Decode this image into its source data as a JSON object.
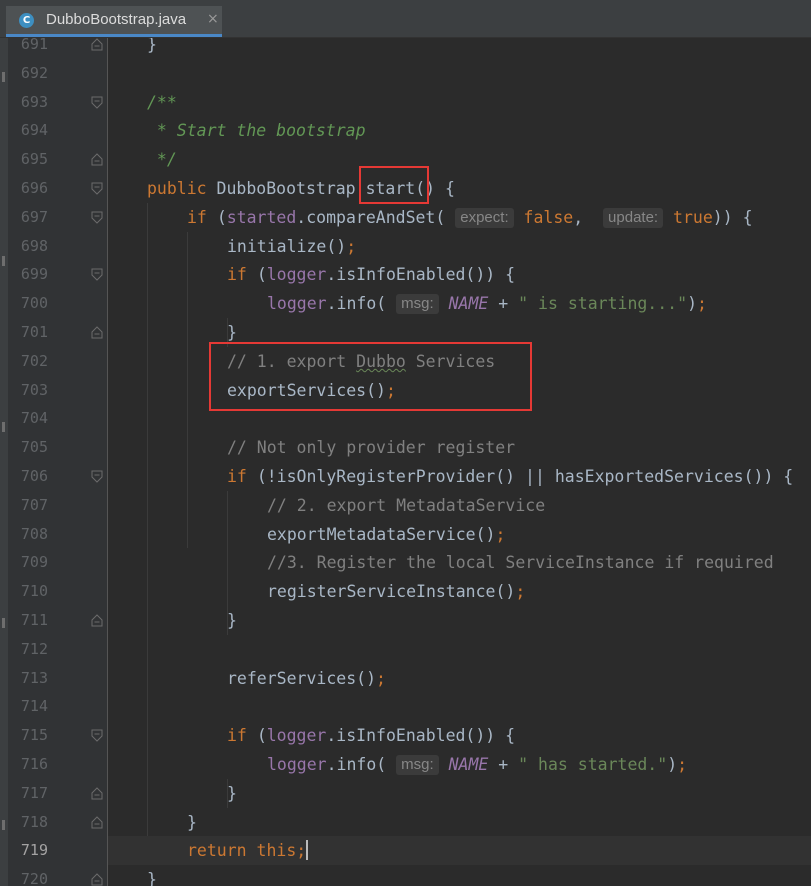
{
  "tab": {
    "icon_letter": "C",
    "label": "DubboBootstrap.java",
    "close": "×"
  },
  "rows": [
    {
      "ln": "691",
      "fold": "end",
      "indent": 1,
      "segs": [
        [
          "p",
          "}"
        ]
      ]
    },
    {
      "ln": "692",
      "fold": "",
      "indent": 0,
      "segs": []
    },
    {
      "ln": "693",
      "fold": "start",
      "indent": 1,
      "segs": [
        [
          "doc",
          "/**"
        ]
      ]
    },
    {
      "ln": "694",
      "fold": "",
      "indent": 1,
      "segs": [
        [
          "doc",
          " * Start the bootstrap"
        ]
      ]
    },
    {
      "ln": "695",
      "fold": "end",
      "indent": 1,
      "segs": [
        [
          "doc",
          " */"
        ]
      ]
    },
    {
      "ln": "696",
      "fold": "start",
      "indent": 1,
      "segs": [
        [
          "kw",
          "public "
        ],
        [
          "p",
          "DubboBootstrap "
        ],
        [
          "p",
          "start"
        ],
        [
          "p",
          "() {"
        ]
      ]
    },
    {
      "ln": "697",
      "fold": "start",
      "indent": 2,
      "segs": [
        [
          "kw",
          "if "
        ],
        [
          "p",
          "("
        ],
        [
          "field",
          "started"
        ],
        [
          "p",
          ".compareAndSet( "
        ],
        [
          "hint",
          "expect:"
        ],
        [
          "kw",
          " false"
        ],
        [
          "p",
          ",  "
        ],
        [
          "hint",
          "update:"
        ],
        [
          "kw",
          " true"
        ],
        [
          "p",
          ")) {"
        ]
      ]
    },
    {
      "ln": "698",
      "fold": "",
      "indent": 3,
      "segs": [
        [
          "p",
          "initialize()"
        ],
        [
          "kw",
          ";"
        ]
      ]
    },
    {
      "ln": "699",
      "fold": "start",
      "indent": 3,
      "segs": [
        [
          "kw",
          "if "
        ],
        [
          "p",
          "("
        ],
        [
          "field",
          "logger"
        ],
        [
          "p",
          ".isInfoEnabled()) {"
        ]
      ]
    },
    {
      "ln": "700",
      "fold": "",
      "indent": 4,
      "segs": [
        [
          "field",
          "logger"
        ],
        [
          "p",
          ".info( "
        ],
        [
          "hint",
          "msg:"
        ],
        [
          "p",
          " "
        ],
        [
          "const",
          "NAME"
        ],
        [
          "p",
          " + "
        ],
        [
          "str",
          "\" is starting...\""
        ],
        [
          "p",
          ")"
        ],
        [
          "kw",
          ";"
        ]
      ]
    },
    {
      "ln": "701",
      "fold": "end",
      "indent": 3,
      "segs": [
        [
          "p",
          "}"
        ]
      ]
    },
    {
      "ln": "702",
      "fold": "",
      "indent": 3,
      "segs": [
        [
          "cmt",
          "// 1. export "
        ],
        [
          "cmtu",
          "Dubbo"
        ],
        [
          "cmt",
          " Services"
        ]
      ]
    },
    {
      "ln": "703",
      "fold": "",
      "indent": 3,
      "segs": [
        [
          "p",
          "exportServices()"
        ],
        [
          "kw",
          ";"
        ]
      ]
    },
    {
      "ln": "704",
      "fold": "",
      "indent": 0,
      "segs": []
    },
    {
      "ln": "705",
      "fold": "",
      "indent": 3,
      "segs": [
        [
          "cmt",
          "// Not only provider register"
        ]
      ]
    },
    {
      "ln": "706",
      "fold": "start",
      "indent": 3,
      "segs": [
        [
          "kw",
          "if "
        ],
        [
          "p",
          "(!isOnlyRegisterProvider() || hasExportedServices()) {"
        ]
      ]
    },
    {
      "ln": "707",
      "fold": "",
      "indent": 4,
      "segs": [
        [
          "cmt",
          "// 2. export MetadataService"
        ]
      ]
    },
    {
      "ln": "708",
      "fold": "",
      "indent": 4,
      "segs": [
        [
          "p",
          "exportMetadataService()"
        ],
        [
          "kw",
          ";"
        ]
      ]
    },
    {
      "ln": "709",
      "fold": "",
      "indent": 4,
      "segs": [
        [
          "cmt",
          "//3. Register the local ServiceInstance if required"
        ]
      ]
    },
    {
      "ln": "710",
      "fold": "",
      "indent": 4,
      "segs": [
        [
          "p",
          "registerServiceInstance()"
        ],
        [
          "kw",
          ";"
        ]
      ]
    },
    {
      "ln": "711",
      "fold": "end",
      "indent": 3,
      "segs": [
        [
          "p",
          "}"
        ]
      ]
    },
    {
      "ln": "712",
      "fold": "",
      "indent": 0,
      "segs": []
    },
    {
      "ln": "713",
      "fold": "",
      "indent": 3,
      "segs": [
        [
          "p",
          "referServices()"
        ],
        [
          "kw",
          ";"
        ]
      ]
    },
    {
      "ln": "714",
      "fold": "",
      "indent": 0,
      "segs": []
    },
    {
      "ln": "715",
      "fold": "start",
      "indent": 3,
      "segs": [
        [
          "kw",
          "if "
        ],
        [
          "p",
          "("
        ],
        [
          "field",
          "logger"
        ],
        [
          "p",
          ".isInfoEnabled()) {"
        ]
      ]
    },
    {
      "ln": "716",
      "fold": "",
      "indent": 4,
      "segs": [
        [
          "field",
          "logger"
        ],
        [
          "p",
          ".info( "
        ],
        [
          "hint",
          "msg:"
        ],
        [
          "p",
          " "
        ],
        [
          "const",
          "NAME"
        ],
        [
          "p",
          " + "
        ],
        [
          "str",
          "\" has started.\""
        ],
        [
          "p",
          ")"
        ],
        [
          "kw",
          ";"
        ]
      ]
    },
    {
      "ln": "717",
      "fold": "end",
      "indent": 3,
      "segs": [
        [
          "p",
          "}"
        ]
      ]
    },
    {
      "ln": "718",
      "fold": "end",
      "indent": 2,
      "segs": [
        [
          "p",
          "}"
        ]
      ]
    },
    {
      "ln": "719",
      "fold": "",
      "indent": 2,
      "current": true,
      "segs": [
        [
          "kw",
          "return this;"
        ],
        [
          "caret",
          ""
        ]
      ]
    },
    {
      "ln": "720",
      "fold": "end",
      "indent": 1,
      "segs": [
        [
          "p",
          "}"
        ]
      ]
    }
  ],
  "colors": {
    "background": "#2b2b2b",
    "gutter": "#313335",
    "keyword": "#cc7832",
    "field": "#9876aa",
    "string": "#6a8759",
    "comment": "#808080",
    "doc_comment": "#629755",
    "highlight_box": "#e53935",
    "tab_underline": "#4a88c7"
  },
  "annotations": [
    {
      "name": "start-method-highlight"
    },
    {
      "name": "export-services-highlight"
    }
  ]
}
